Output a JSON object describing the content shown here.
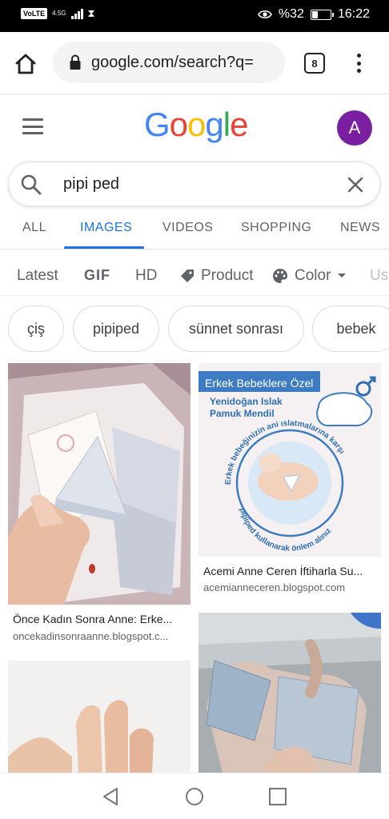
{
  "status_bar": {
    "volte": "VoLTE",
    "network": "4.5G",
    "battery_percent": "%32",
    "time": "16:22",
    "battery_level": 0.32
  },
  "browser": {
    "url": "google.com/search?q=",
    "tab_count": "8",
    "icons": [
      "home-icon",
      "lock-icon",
      "tabs-icon",
      "more-vert-icon"
    ]
  },
  "google": {
    "logo": [
      "G",
      "o",
      "o",
      "g",
      "l",
      "e"
    ],
    "logo_colors": [
      "#4285F4",
      "#EA4335",
      "#FBBC05",
      "#4285F4",
      "#34A853",
      "#EA4335"
    ],
    "avatar_letter": "A",
    "avatar_color": "#7b1fa2"
  },
  "search": {
    "query": "pipi ped"
  },
  "tabs": [
    {
      "label": "ALL"
    },
    {
      "label": "IMAGES",
      "active": true
    },
    {
      "label": "VIDEOS"
    },
    {
      "label": "SHOPPING"
    },
    {
      "label": "NEWS"
    }
  ],
  "filters": [
    {
      "label": "Latest"
    },
    {
      "label": "GIF"
    },
    {
      "label": "HD"
    },
    {
      "label": "Product",
      "icon": "tag-icon"
    },
    {
      "label": "Color",
      "icon": "palette-icon"
    },
    {
      "label": "Us"
    }
  ],
  "chips": [
    "çiş",
    "pipiped",
    "sünnet sonrası",
    "bebek"
  ],
  "results": [
    {
      "title": "Önce Kadın Sonra Anne: Erke...",
      "source": "oncekadinsonraanne.blogspot.c..."
    },
    {
      "title": "Acemi Anne Ceren İftiharla Su...",
      "source": "acemianneceren.blogspot.com",
      "image_text": {
        "banner": "Erkek Bebeklere Özel",
        "subtitle1": "Yenidoğan Islak",
        "subtitle2": "Pamuk Mendil",
        "arc_top": "Erkek bebeğinizin ani ıslatmalarına karşı",
        "arc_bottom": "pipiped kullanarak önlem alınız"
      }
    },
    {
      "title": "",
      "source": ""
    },
    {
      "title": "",
      "source": ""
    }
  ],
  "accent": "#1a73e8"
}
